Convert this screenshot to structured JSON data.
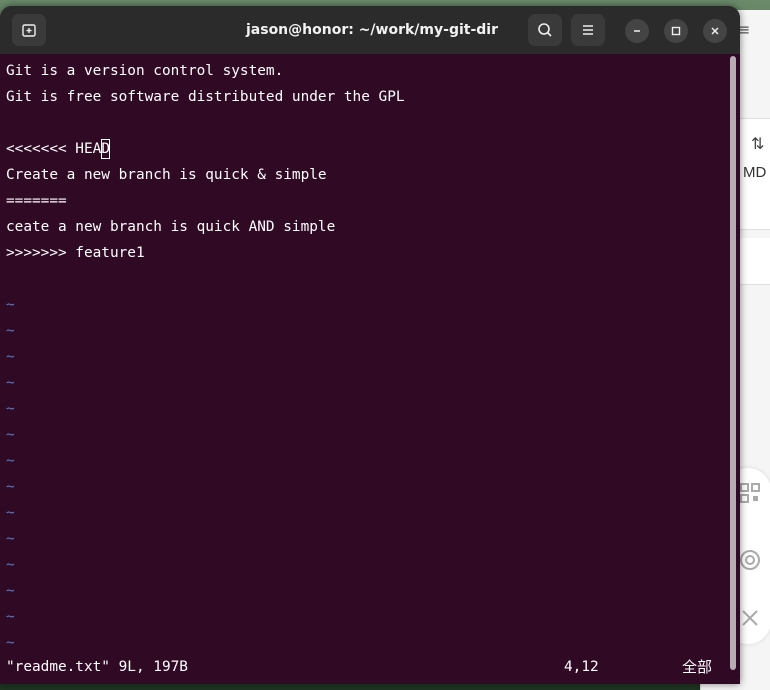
{
  "window": {
    "title": "jason@honor: ~/work/my-git-dir"
  },
  "editor": {
    "lines": [
      "Git is a version control system.",
      "Git is free software distributed under the GPL",
      "",
      "<<<<<<< HEAD",
      "Create a new branch is quick & simple",
      "=======",
      "ceate a new branch is quick AND simple",
      ">>>>>>> feature1"
    ],
    "cursor_line_prefix": "<<<<<<< HEA",
    "cursor_char": "D",
    "empty_marker": "~",
    "status_file": "\"readme.txt\" 9L, 197B",
    "status_position": "4,12",
    "status_scroll": "全部"
  },
  "background_window": {
    "sort_glyph": "⇅",
    "text": "MD",
    "menu_glyph": "≡"
  },
  "colors": {
    "terminal_bg": "#300a24",
    "titlebar_bg": "#2b2b2b",
    "tilde": "#5a78c8"
  }
}
